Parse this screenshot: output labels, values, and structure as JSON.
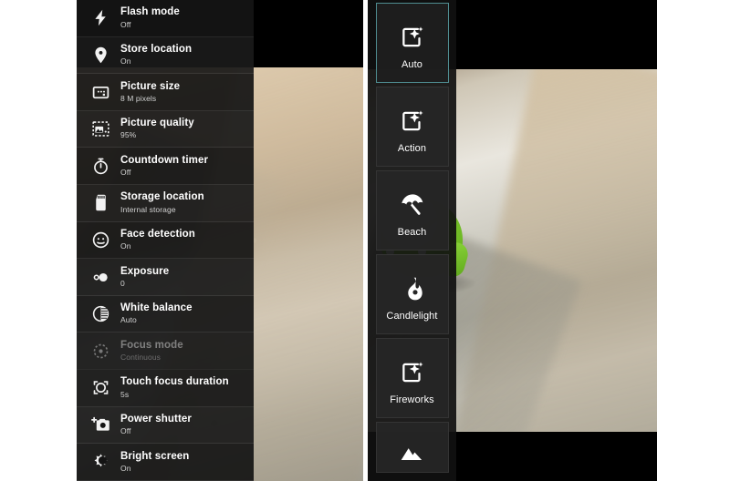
{
  "left_screenshot": {
    "name": "camera-settings-menu",
    "settings": [
      {
        "icon": "flash-icon",
        "title": "Flash mode",
        "value": "Off",
        "disabled": false
      },
      {
        "icon": "location-pin-icon",
        "title": "Store location",
        "value": "On",
        "disabled": false
      },
      {
        "icon": "picture-size-icon",
        "title": "Picture size",
        "value": "8 M pixels",
        "disabled": false
      },
      {
        "icon": "picture-quality-icon",
        "title": "Picture quality",
        "value": "95%",
        "disabled": false
      },
      {
        "icon": "stopwatch-icon",
        "title": "Countdown timer",
        "value": "Off",
        "disabled": false
      },
      {
        "icon": "sd-card-icon",
        "title": "Storage location",
        "value": "Internal storage",
        "disabled": false
      },
      {
        "icon": "face-detection-icon",
        "title": "Face detection",
        "value": "On",
        "disabled": false
      },
      {
        "icon": "exposure-icon",
        "title": "Exposure",
        "value": "0",
        "disabled": false
      },
      {
        "icon": "white-balance-icon",
        "title": "White balance",
        "value": "Auto",
        "disabled": false
      },
      {
        "icon": "focus-mode-icon",
        "title": "Focus mode",
        "value": "Continuous",
        "disabled": true
      },
      {
        "icon": "touch-focus-icon",
        "title": "Touch focus duration",
        "value": "5s",
        "disabled": false
      },
      {
        "icon": "power-shutter-icon",
        "title": "Power shutter",
        "value": "Off",
        "disabled": false
      },
      {
        "icon": "bright-screen-icon",
        "title": "Bright screen",
        "value": "On",
        "disabled": false
      }
    ]
  },
  "right_screenshot": {
    "name": "scene-mode-picker",
    "scene_modes": [
      {
        "icon": "auto-scene-icon",
        "label": "Auto",
        "selected": true,
        "partial": false
      },
      {
        "icon": "action-scene-icon",
        "label": "Action",
        "selected": false,
        "partial": false
      },
      {
        "icon": "beach-umbrella-icon",
        "label": "Beach",
        "selected": false,
        "partial": false
      },
      {
        "icon": "flame-icon",
        "label": "Candlelight",
        "selected": false,
        "partial": false
      },
      {
        "icon": "fireworks-icon",
        "label": "Fireworks",
        "selected": false,
        "partial": false
      },
      {
        "icon": "mountain-icon",
        "label": "",
        "selected": false,
        "partial": true
      }
    ],
    "viewfinder_subject": "green android mascot figurine on tiled floor"
  },
  "colors": {
    "selected_tile_border": "#4f8d91",
    "panel_background": "#141414",
    "tile_background": "#262626",
    "text_primary": "#ffffff",
    "text_secondary": "#d2d2d2",
    "page_background": "#ffffff"
  }
}
